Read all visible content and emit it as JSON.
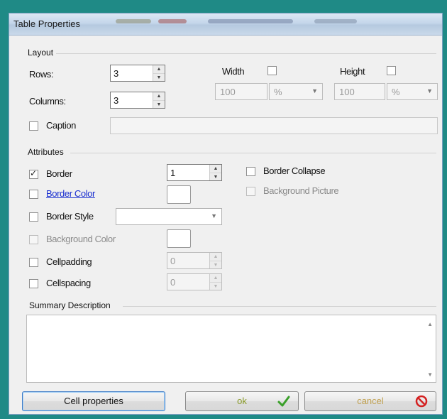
{
  "window": {
    "title": "Table Properties"
  },
  "layout": {
    "group_label": "Layout",
    "rows_label": "Rows:",
    "rows_value": "3",
    "columns_label": "Columns:",
    "columns_value": "3",
    "width_label": "Width",
    "width_value": "100",
    "width_unit": "%",
    "height_label": "Height",
    "height_value": "100",
    "height_unit": "%",
    "caption_label": "Caption"
  },
  "attributes": {
    "group_label": "Attributes",
    "border_label": "Border",
    "border_value": "1",
    "border_color_label": "Border Color",
    "border_style_label": "Border Style",
    "background_color_label": "Background Color",
    "cellpadding_label": "Cellpadding",
    "cellpadding_value": "0",
    "cellspacing_label": "Cellspacing",
    "cellspacing_value": "0",
    "border_collapse_label": "Border Collapse",
    "background_picture_label": "Background Picture"
  },
  "summary": {
    "label": "Summary Description"
  },
  "buttons": {
    "cell_properties": "Cell properties",
    "ok": "ok",
    "cancel": "cancel"
  },
  "colors": {
    "ok_check": "#3aa02a",
    "cancel_icon": "#d42020",
    "link": "#1a2fd0"
  }
}
